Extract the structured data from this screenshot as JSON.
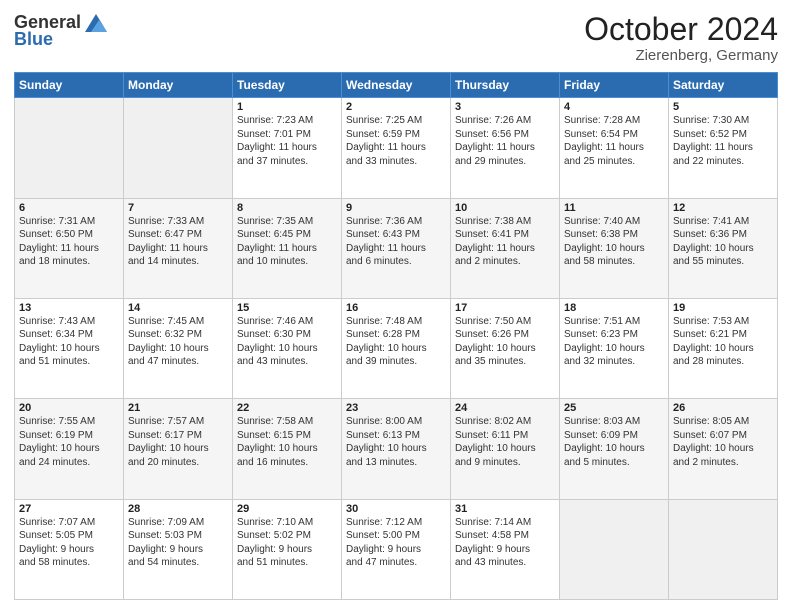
{
  "header": {
    "logo_general": "General",
    "logo_blue": "Blue",
    "title": "October 2024",
    "location": "Zierenberg, Germany"
  },
  "weekdays": [
    "Sunday",
    "Monday",
    "Tuesday",
    "Wednesday",
    "Thursday",
    "Friday",
    "Saturday"
  ],
  "rows": [
    [
      {
        "day": "",
        "info": ""
      },
      {
        "day": "",
        "info": ""
      },
      {
        "day": "1",
        "info": "Sunrise: 7:23 AM\nSunset: 7:01 PM\nDaylight: 11 hours\nand 37 minutes."
      },
      {
        "day": "2",
        "info": "Sunrise: 7:25 AM\nSunset: 6:59 PM\nDaylight: 11 hours\nand 33 minutes."
      },
      {
        "day": "3",
        "info": "Sunrise: 7:26 AM\nSunset: 6:56 PM\nDaylight: 11 hours\nand 29 minutes."
      },
      {
        "day": "4",
        "info": "Sunrise: 7:28 AM\nSunset: 6:54 PM\nDaylight: 11 hours\nand 25 minutes."
      },
      {
        "day": "5",
        "info": "Sunrise: 7:30 AM\nSunset: 6:52 PM\nDaylight: 11 hours\nand 22 minutes."
      }
    ],
    [
      {
        "day": "6",
        "info": "Sunrise: 7:31 AM\nSunset: 6:50 PM\nDaylight: 11 hours\nand 18 minutes."
      },
      {
        "day": "7",
        "info": "Sunrise: 7:33 AM\nSunset: 6:47 PM\nDaylight: 11 hours\nand 14 minutes."
      },
      {
        "day": "8",
        "info": "Sunrise: 7:35 AM\nSunset: 6:45 PM\nDaylight: 11 hours\nand 10 minutes."
      },
      {
        "day": "9",
        "info": "Sunrise: 7:36 AM\nSunset: 6:43 PM\nDaylight: 11 hours\nand 6 minutes."
      },
      {
        "day": "10",
        "info": "Sunrise: 7:38 AM\nSunset: 6:41 PM\nDaylight: 11 hours\nand 2 minutes."
      },
      {
        "day": "11",
        "info": "Sunrise: 7:40 AM\nSunset: 6:38 PM\nDaylight: 10 hours\nand 58 minutes."
      },
      {
        "day": "12",
        "info": "Sunrise: 7:41 AM\nSunset: 6:36 PM\nDaylight: 10 hours\nand 55 minutes."
      }
    ],
    [
      {
        "day": "13",
        "info": "Sunrise: 7:43 AM\nSunset: 6:34 PM\nDaylight: 10 hours\nand 51 minutes."
      },
      {
        "day": "14",
        "info": "Sunrise: 7:45 AM\nSunset: 6:32 PM\nDaylight: 10 hours\nand 47 minutes."
      },
      {
        "day": "15",
        "info": "Sunrise: 7:46 AM\nSunset: 6:30 PM\nDaylight: 10 hours\nand 43 minutes."
      },
      {
        "day": "16",
        "info": "Sunrise: 7:48 AM\nSunset: 6:28 PM\nDaylight: 10 hours\nand 39 minutes."
      },
      {
        "day": "17",
        "info": "Sunrise: 7:50 AM\nSunset: 6:26 PM\nDaylight: 10 hours\nand 35 minutes."
      },
      {
        "day": "18",
        "info": "Sunrise: 7:51 AM\nSunset: 6:23 PM\nDaylight: 10 hours\nand 32 minutes."
      },
      {
        "day": "19",
        "info": "Sunrise: 7:53 AM\nSunset: 6:21 PM\nDaylight: 10 hours\nand 28 minutes."
      }
    ],
    [
      {
        "day": "20",
        "info": "Sunrise: 7:55 AM\nSunset: 6:19 PM\nDaylight: 10 hours\nand 24 minutes."
      },
      {
        "day": "21",
        "info": "Sunrise: 7:57 AM\nSunset: 6:17 PM\nDaylight: 10 hours\nand 20 minutes."
      },
      {
        "day": "22",
        "info": "Sunrise: 7:58 AM\nSunset: 6:15 PM\nDaylight: 10 hours\nand 16 minutes."
      },
      {
        "day": "23",
        "info": "Sunrise: 8:00 AM\nSunset: 6:13 PM\nDaylight: 10 hours\nand 13 minutes."
      },
      {
        "day": "24",
        "info": "Sunrise: 8:02 AM\nSunset: 6:11 PM\nDaylight: 10 hours\nand 9 minutes."
      },
      {
        "day": "25",
        "info": "Sunrise: 8:03 AM\nSunset: 6:09 PM\nDaylight: 10 hours\nand 5 minutes."
      },
      {
        "day": "26",
        "info": "Sunrise: 8:05 AM\nSunset: 6:07 PM\nDaylight: 10 hours\nand 2 minutes."
      }
    ],
    [
      {
        "day": "27",
        "info": "Sunrise: 7:07 AM\nSunset: 5:05 PM\nDaylight: 9 hours\nand 58 minutes."
      },
      {
        "day": "28",
        "info": "Sunrise: 7:09 AM\nSunset: 5:03 PM\nDaylight: 9 hours\nand 54 minutes."
      },
      {
        "day": "29",
        "info": "Sunrise: 7:10 AM\nSunset: 5:02 PM\nDaylight: 9 hours\nand 51 minutes."
      },
      {
        "day": "30",
        "info": "Sunrise: 7:12 AM\nSunset: 5:00 PM\nDaylight: 9 hours\nand 47 minutes."
      },
      {
        "day": "31",
        "info": "Sunrise: 7:14 AM\nSunset: 4:58 PM\nDaylight: 9 hours\nand 43 minutes."
      },
      {
        "day": "",
        "info": ""
      },
      {
        "day": "",
        "info": ""
      }
    ]
  ]
}
